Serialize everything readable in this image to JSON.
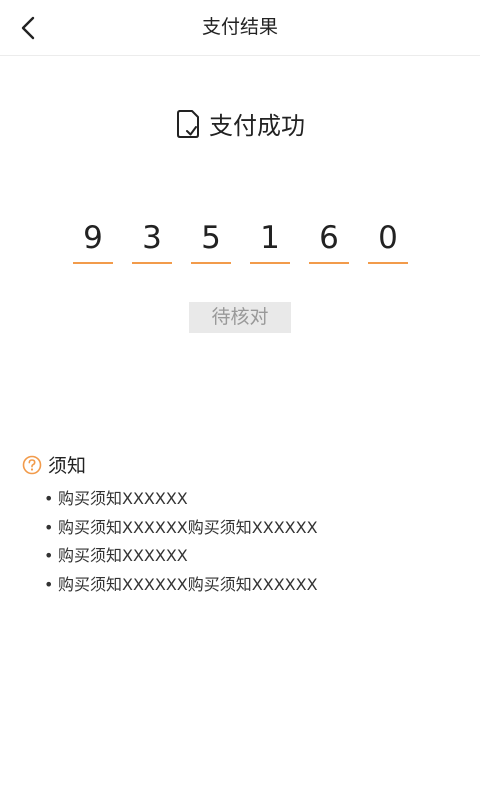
{
  "nav": {
    "back_icon": "chevron-left-icon",
    "title": "支付结果"
  },
  "result": {
    "icon": "document-check-icon",
    "text": "支付成功"
  },
  "verification_code": {
    "digits": [
      "9",
      "3",
      "5",
      "1",
      "6",
      "0"
    ],
    "underline_color": "#f29b4b"
  },
  "status": {
    "label": "待核对"
  },
  "notice": {
    "icon": "question-circle-icon",
    "accent_color": "#f29b4b",
    "title": "须知",
    "items": [
      "购买须知XXXXXX",
      "购买须知XXXXXX购买须知XXXXXX",
      "购买须知XXXXXX",
      "购买须知XXXXXX购买须知XXXXXX"
    ]
  }
}
